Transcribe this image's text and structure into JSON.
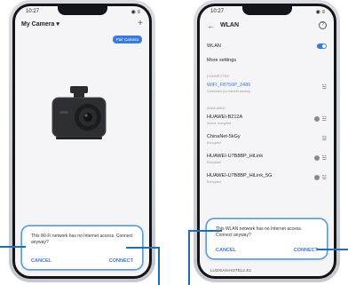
{
  "left_phone": {
    "status_time": "10:27",
    "status_icons": "◉ ≡",
    "title": "My Camera",
    "title_arrow": "▾",
    "add_icon": "+",
    "pill_button": "Pair Camera",
    "dialog": {
      "message": "This Wi-Fi network has no Internet access. Connect anyway?",
      "cancel": "CANCEL",
      "connect": "CONNECT"
    }
  },
  "right_phone": {
    "status_time": "10:27",
    "status_icons": "◉ ≡",
    "title": "WLAN",
    "wlan_label": "WLAN",
    "more_settings": "More settings",
    "connected_label": "CONNECTED",
    "connected_network": {
      "name": "WIFI_F8750P_2486",
      "sub": "Connected (no Internet access)"
    },
    "available_label": "AVAILABLE",
    "networks": [
      {
        "name": "HUAWEI-B212A",
        "sub": "Saved, encrypted"
      },
      {
        "name": "ChinaNet-5kGy",
        "sub": "Encrypted"
      },
      {
        "name": "HUAWEI-U7B8BP_HiLink",
        "sub": "Encrypted"
      },
      {
        "name": "HUAWEI-U7B8BP_HiLink_5G",
        "sub": "Encrypted"
      }
    ],
    "dialog": {
      "message": "This WLAN network has no Internet access. Connect anyway?",
      "cancel": "CANCEL",
      "connect": "CONNECT"
    },
    "bottom_network": "LUOXIAN-HOTEL2.4G"
  },
  "colors": {
    "accent": "#3a7be0",
    "callout": "#1f6fb8"
  }
}
